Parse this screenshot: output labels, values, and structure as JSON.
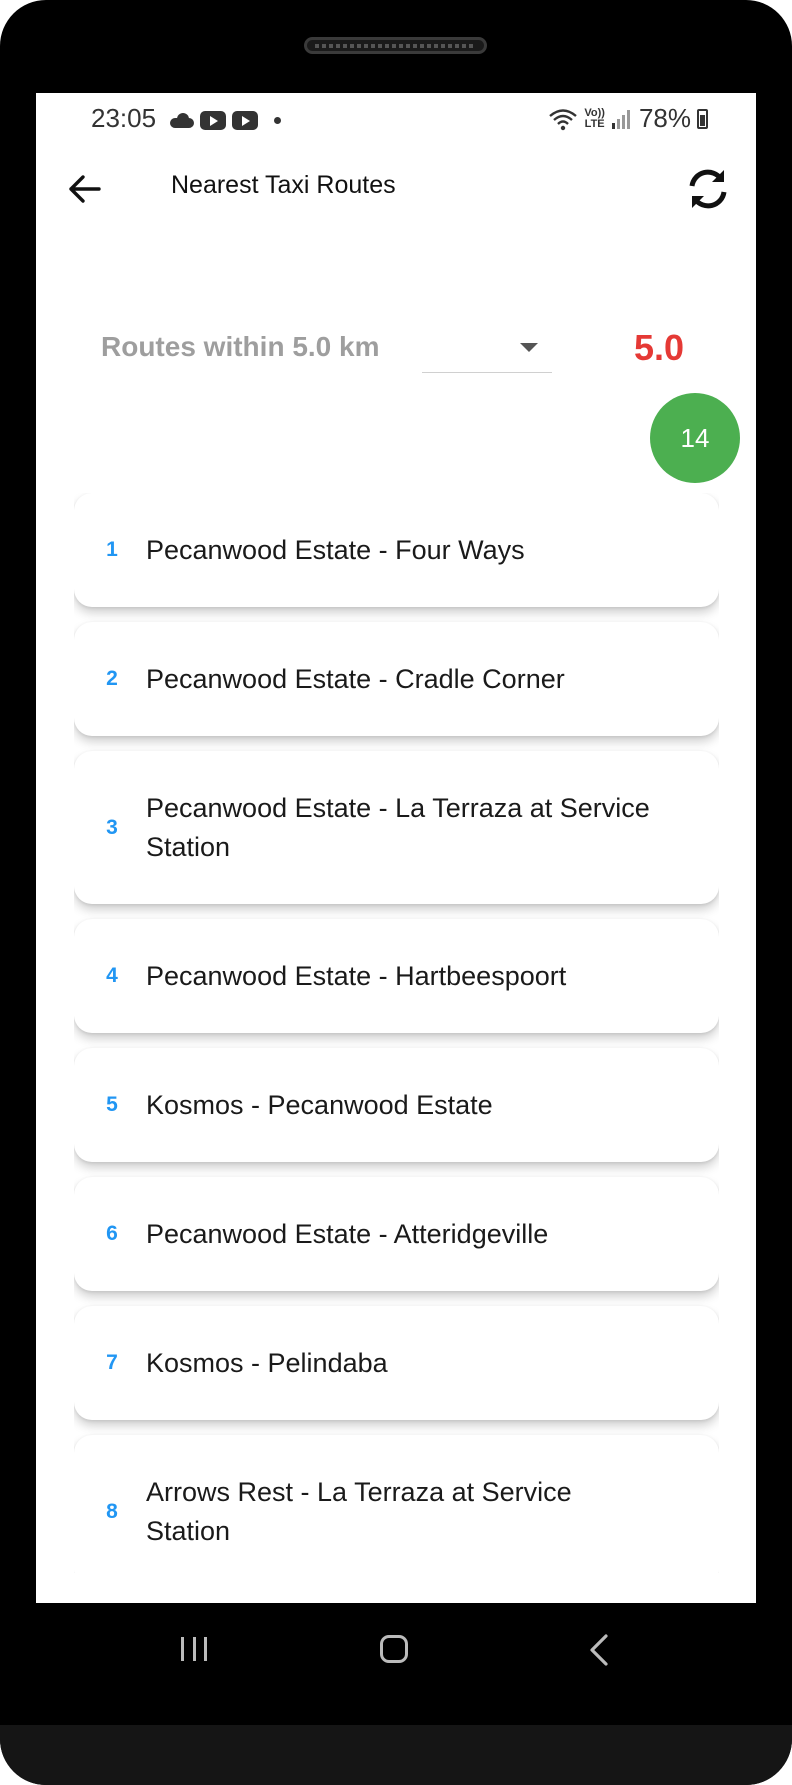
{
  "status_bar": {
    "time": "23:05",
    "battery": "78%",
    "left_icons": [
      "cloud-icon",
      "youtube-icon",
      "youtube-icon",
      "dot-icon"
    ],
    "right_icons": [
      "wifi-icon",
      "volte-icon",
      "signal-icon",
      "battery-icon"
    ],
    "lte_top": "Vo))",
    "lte_bottom": "LTE"
  },
  "app_bar": {
    "title": "Nearest Taxi Routes",
    "back_icon": "arrow-left-icon",
    "refresh_icon": "refresh-icon"
  },
  "filter": {
    "label": "Routes within 5.0 km",
    "distance_value": "5.0",
    "distance_color": "#e53935",
    "route_count": "14",
    "badge_color": "#4caf50"
  },
  "routes": [
    {
      "index": "1",
      "name": "Pecanwood Estate  - Four Ways"
    },
    {
      "index": "2",
      "name": "Pecanwood Estate  - Cradle Corner"
    },
    {
      "index": "3",
      "name": "Pecanwood Estate  - La Terraza at Service Station"
    },
    {
      "index": "4",
      "name": "Pecanwood Estate  - Hartbeespoort"
    },
    {
      "index": "5",
      "name": "Kosmos - Pecanwood Estate"
    },
    {
      "index": "6",
      "name": "Pecanwood Estate  - Atteridgeville"
    },
    {
      "index": "7",
      "name": "Kosmos - Pelindaba"
    },
    {
      "index": "8",
      "name": "Arrows Rest - La Terraza at Service Station"
    }
  ],
  "colors": {
    "index_color": "#2196f3",
    "label_color": "#9e9e9e"
  },
  "nav_bar": {
    "icons": [
      "recents-icon",
      "home-icon",
      "back-icon"
    ]
  }
}
